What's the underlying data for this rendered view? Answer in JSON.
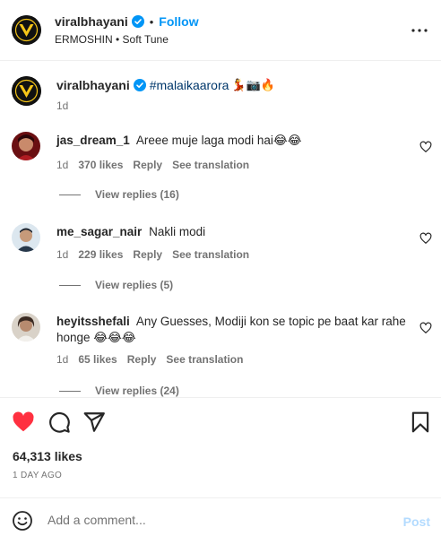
{
  "header": {
    "username": "viralbhayani",
    "dot": "•",
    "follow_label": "Follow",
    "audio": "ERMOSHIN • Soft Tune",
    "more_icon": "more-horizontal-icon"
  },
  "caption": {
    "username": "viralbhayani",
    "hashtag": "#malaikaarora",
    "emojis": "💃📷🔥",
    "time": "1d"
  },
  "comments": [
    {
      "username": "jas_dream_1",
      "text": "Areee muje laga modi hai😂😂",
      "time": "1d",
      "likes": "370 likes",
      "reply": "Reply",
      "translate": "See translation",
      "view_replies": "View replies (16)"
    },
    {
      "username": "me_sagar_nair",
      "text": "Nakli modi",
      "time": "1d",
      "likes": "229 likes",
      "reply": "Reply",
      "translate": "See translation",
      "view_replies": "View replies (5)"
    },
    {
      "username": "heyitsshefali",
      "text": "Any Guesses, Modiji kon se topic pe baat kar rahe honge 😂😂😂",
      "time": "1d",
      "likes": "65 likes",
      "reply": "Reply",
      "translate": "See translation",
      "view_replies": "View replies (24)"
    }
  ],
  "actions": {
    "likes": "64,313 likes",
    "time": "1 DAY AGO",
    "liked_color": "#ff3040"
  },
  "composer": {
    "placeholder": "Add a comment...",
    "post_label": "Post"
  },
  "colors": {
    "link_blue": "#0095f6",
    "hashtag": "#00376b",
    "muted": "#737373",
    "post_disabled": "#b3dbff"
  }
}
